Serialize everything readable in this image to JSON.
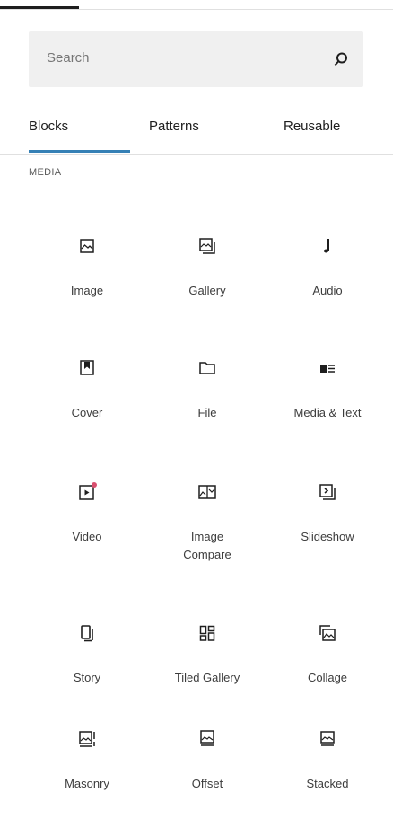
{
  "search": {
    "placeholder": "Search",
    "icon": "search-icon"
  },
  "tabs": [
    {
      "label": "Blocks",
      "active": true
    },
    {
      "label": "Patterns",
      "active": false
    },
    {
      "label": "Reusable",
      "active": false
    }
  ],
  "section_title": "MEDIA",
  "accent_color": "#3580b5",
  "blocks": [
    {
      "label": "Image",
      "icon": "image-icon"
    },
    {
      "label": "Gallery",
      "icon": "gallery-icon"
    },
    {
      "label": "Audio",
      "icon": "audio-icon"
    },
    {
      "label": "Cover",
      "icon": "cover-icon"
    },
    {
      "label": "File",
      "icon": "file-icon"
    },
    {
      "label": "Media & Text",
      "icon": "media-text-icon"
    },
    {
      "label": "Video",
      "icon": "video-icon"
    },
    {
      "label": "Image\nCompare",
      "icon": "image-compare-icon"
    },
    {
      "label": "Slideshow",
      "icon": "slideshow-icon"
    },
    {
      "label": "Story",
      "icon": "story-icon"
    },
    {
      "label": "Tiled Gallery",
      "icon": "tiled-gallery-icon"
    },
    {
      "label": "Collage",
      "icon": "collage-icon"
    },
    {
      "label": "Masonry",
      "icon": "masonry-icon"
    },
    {
      "label": "Offset",
      "icon": "offset-icon"
    },
    {
      "label": "Stacked",
      "icon": "stacked-icon"
    }
  ]
}
